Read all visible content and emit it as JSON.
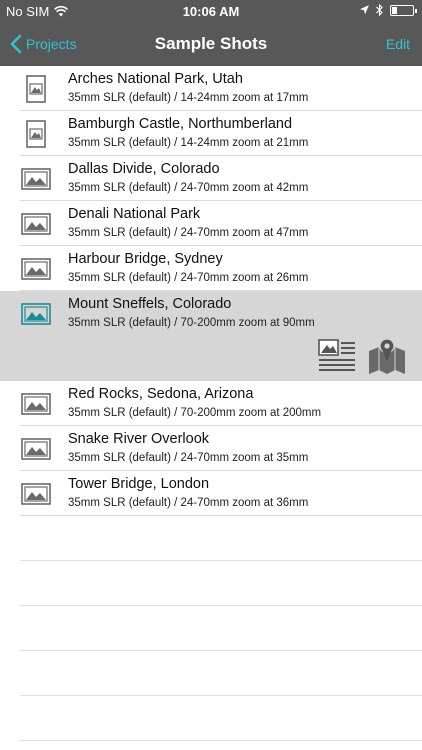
{
  "status_bar": {
    "carrier": "No SIM",
    "time": "10:06 AM",
    "battery_level": 0.25
  },
  "nav": {
    "back_label": "Projects",
    "title": "Sample Shots",
    "edit_label": "Edit"
  },
  "colors": {
    "accent": "#30c4d4",
    "bar": "#585858",
    "selected_row": "#d6d6d6"
  },
  "shots": [
    {
      "title": "Arches National Park, Utah",
      "subtitle": "35mm SLR (default) / 14-24mm zoom at 17mm",
      "orientation": "portrait",
      "selected": false
    },
    {
      "title": "Bamburgh Castle, Northumberland",
      "subtitle": "35mm SLR (default) / 14-24mm zoom at 21mm",
      "orientation": "portrait",
      "selected": false
    },
    {
      "title": "Dallas Divide, Colorado",
      "subtitle": "35mm SLR (default) / 24-70mm zoom at 42mm",
      "orientation": "landscape",
      "selected": false
    },
    {
      "title": "Denali National Park",
      "subtitle": "35mm SLR (default) / 24-70mm zoom at 47mm",
      "orientation": "landscape",
      "selected": false
    },
    {
      "title": "Harbour Bridge, Sydney",
      "subtitle": "35mm SLR (default) / 24-70mm zoom at 26mm",
      "orientation": "landscape",
      "selected": false
    },
    {
      "title": "Mount Sneffels, Colorado",
      "subtitle": "35mm SLR (default) / 70-200mm zoom at 90mm",
      "orientation": "landscape",
      "selected": true
    },
    {
      "title": "Red Rocks, Sedona, Arizona",
      "subtitle": "35mm SLR (default) / 70-200mm zoom at 200mm",
      "orientation": "landscape",
      "selected": false
    },
    {
      "title": "Snake River Overlook",
      "subtitle": "35mm SLR (default) / 24-70mm zoom at 35mm",
      "orientation": "landscape",
      "selected": false
    },
    {
      "title": "Tower Bridge, London",
      "subtitle": "35mm SLR (default) / 24-70mm zoom at 36mm",
      "orientation": "landscape",
      "selected": false
    }
  ],
  "row_actions": [
    "details-icon",
    "map-pin-icon"
  ]
}
